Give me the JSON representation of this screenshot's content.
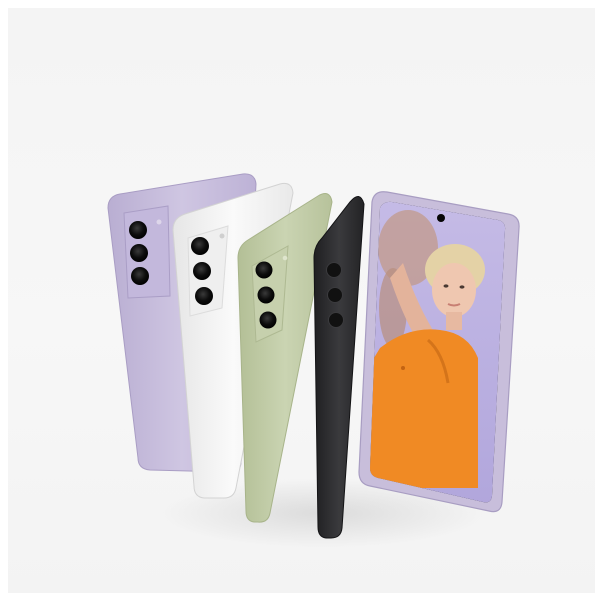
{
  "scene": {
    "subject": "smartphones",
    "phone_count": 5,
    "colors": {
      "background": "#f5f5f5",
      "lavender": "#c9bfdc",
      "white": "#f2f2f2",
      "olive": "#c3cda8",
      "graphite": "#2c2c2e",
      "screen_bg": "#b9aee0",
      "shirt": "#f08a24"
    },
    "phones": [
      {
        "color_name": "lavender",
        "facing": "back",
        "cameras": 3
      },
      {
        "color_name": "white",
        "facing": "back",
        "cameras": 3
      },
      {
        "color_name": "olive",
        "facing": "back",
        "cameras": 3
      },
      {
        "color_name": "graphite",
        "facing": "back",
        "cameras": 3
      },
      {
        "color_name": "lavender",
        "facing": "front",
        "cameras": 0
      }
    ]
  }
}
